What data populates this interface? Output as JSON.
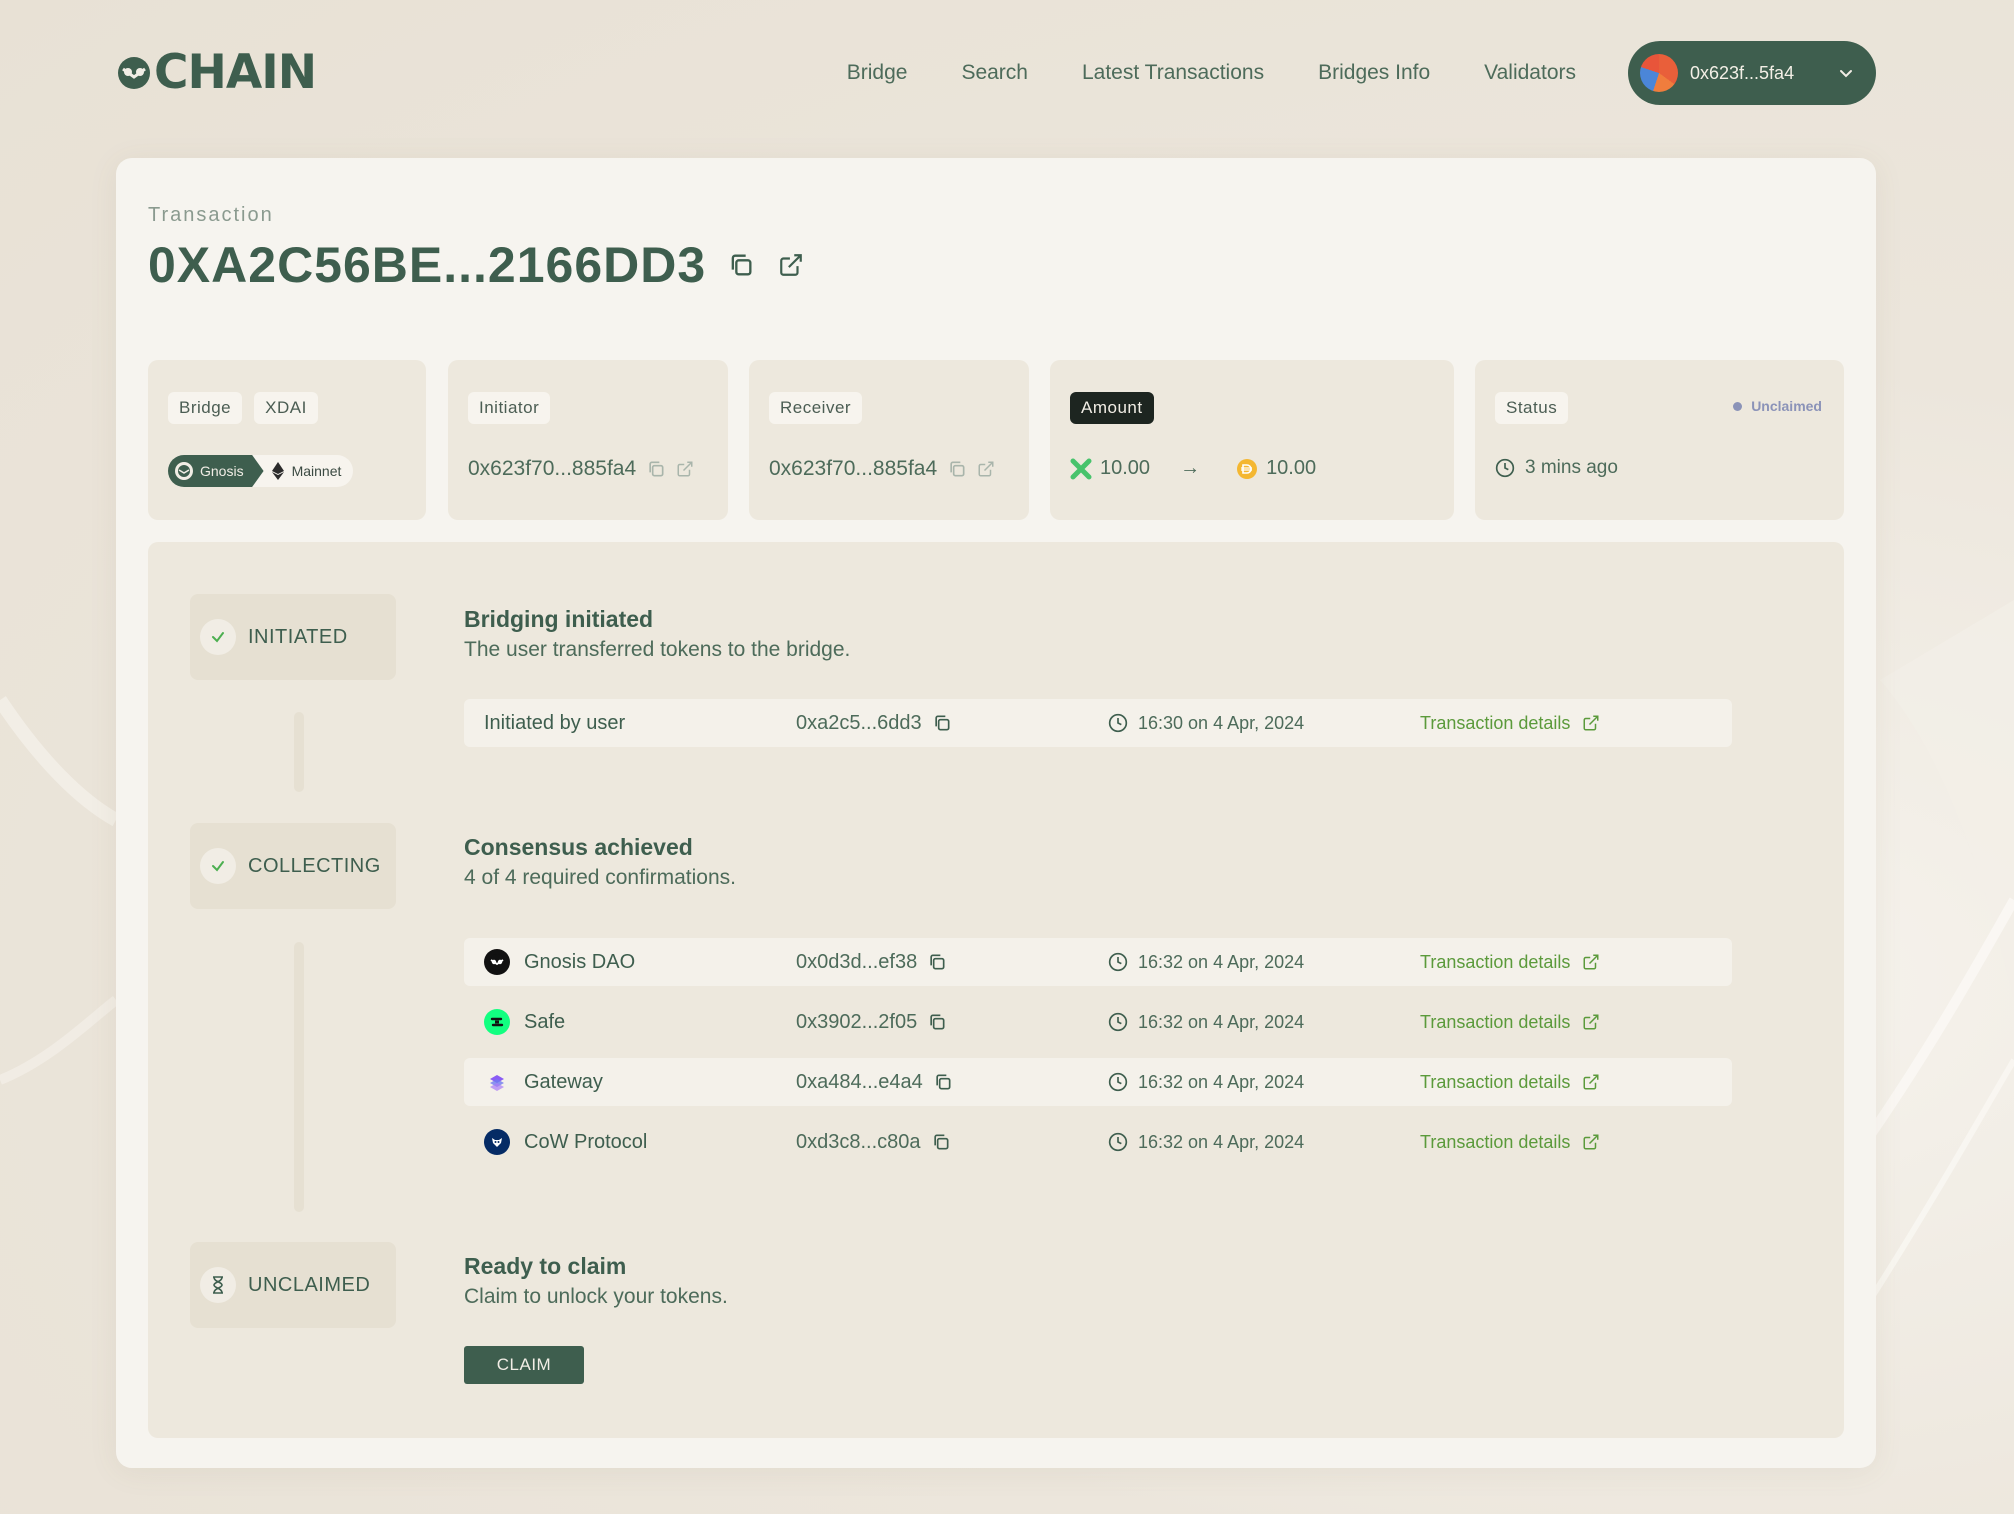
{
  "brand": {
    "logo_text": "CHAIN"
  },
  "nav": {
    "items": [
      {
        "label": "Bridge"
      },
      {
        "label": "Search"
      },
      {
        "label": "Latest Transactions"
      },
      {
        "label": "Bridges Info"
      },
      {
        "label": "Validators"
      }
    ]
  },
  "wallet": {
    "address": "0x623f...5fa4"
  },
  "transaction": {
    "caption": "Transaction",
    "hash": "0XA2C56BE...2166DD3"
  },
  "info": {
    "bridge": {
      "label": "Bridge",
      "token": "XDAI",
      "from_chain": "Gnosis",
      "to_chain": "Mainnet"
    },
    "initiator": {
      "label": "Initiator",
      "address": "0x623f70...885fa4"
    },
    "receiver": {
      "label": "Receiver",
      "address": "0x623f70...885fa4"
    },
    "amount": {
      "label": "Amount",
      "from_value": "10.00",
      "arrow": "→",
      "to_value": "10.00"
    },
    "status": {
      "label": "Status",
      "state": "Unclaimed",
      "time": "3 mins ago"
    }
  },
  "timeline": {
    "initiated": {
      "step_label": "INITIATED",
      "title": "Bridging initiated",
      "subtitle": "The user transferred tokens to the bridge.",
      "row": {
        "name": "Initiated by user",
        "address": "0xa2c5...6dd3",
        "time": "16:30 on 4 Apr, 2024",
        "link": "Transaction details"
      }
    },
    "collecting": {
      "step_label": "COLLECTING",
      "title": "Consensus achieved",
      "subtitle": "4 of 4 required confirmations.",
      "validators": [
        {
          "name": "Gnosis DAO",
          "address": "0x0d3d...ef38",
          "time": "16:32 on 4 Apr, 2024",
          "link": "Transaction details",
          "icon": "gnosis-dao-logo"
        },
        {
          "name": "Safe",
          "address": "0x3902...2f05",
          "time": "16:32 on 4 Apr, 2024",
          "link": "Transaction details",
          "icon": "safe-logo"
        },
        {
          "name": "Gateway",
          "address": "0xa484...e4a4",
          "time": "16:32 on 4 Apr, 2024",
          "link": "Transaction details",
          "icon": "gateway-logo"
        },
        {
          "name": "CoW Protocol",
          "address": "0xd3c8...c80a",
          "time": "16:32 on 4 Apr, 2024",
          "link": "Transaction details",
          "icon": "cow-protocol-logo"
        }
      ]
    },
    "unclaimed": {
      "step_label": "UNCLAIMED",
      "title": "Ready to claim",
      "subtitle": "Claim to unlock your tokens.",
      "button": "CLAIM"
    }
  },
  "colors": {
    "primary": "#3e5e4e",
    "link": "#5b9a3b",
    "status_unclaimed": "#8b93b8",
    "check": "#4caf50"
  }
}
